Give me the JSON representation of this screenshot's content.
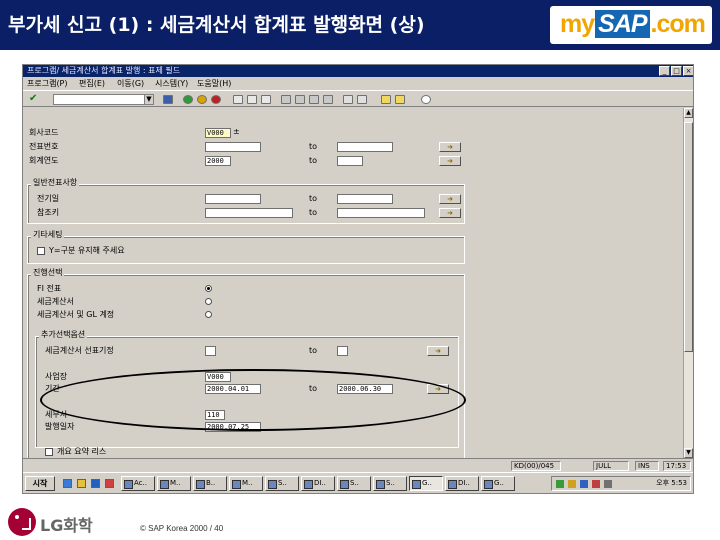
{
  "slide": {
    "title": "부가세 신고 (1) : 세금계산서 합계표 발행화면 (상)",
    "brand_logo": {
      "my": "my",
      "sap": "SAP",
      "com": ".com"
    },
    "company_logo": "LG화학",
    "copyright": "©  SAP Korea 2000 /  40"
  },
  "window": {
    "title": "프로그램/ 세금계산서 합계표 발행 : 표제 필드",
    "controls": [
      "_",
      "□",
      "×"
    ]
  },
  "menu": [
    "프로그램(P)",
    "편집(E)",
    "이동(G)",
    "시스템(Y)",
    "도움말(H)"
  ],
  "toolbar": {
    "enter_icon": "check-icon",
    "command_field": ""
  },
  "selection": {
    "company_code_label": "회사코드",
    "company_code_value": "V000",
    "company_code_marker": "±",
    "doc_no_label": "전표번호",
    "fiscal_year_label": "회계연도",
    "fiscal_year_value": "2000",
    "to": "to"
  },
  "general": {
    "title": "일반전표사항",
    "posting_date_label": "전기일",
    "reference_label": "참조키",
    "to": "to"
  },
  "further": {
    "title": "기타세팅",
    "check_label": "Y=구분 유지해 주세요"
  },
  "processing": {
    "title": "진행선택",
    "opt1": "FI 전표",
    "opt2": "세금계산서",
    "opt3": "세금계산서 및 GL 계정",
    "sub_title": "추가선택옵션",
    "tax_type_label": "세금계산서 선표기정",
    "business_place_label": "사업장",
    "business_place_value": "V000",
    "period_label": "기간",
    "period_from": "2000.04.01",
    "period_to": "2000.06.30",
    "tax_office_label": "세무서",
    "tax_office_value": "110",
    "issue_date_label": "발행일자",
    "issue_date_value": "2000.07.25",
    "to": "to",
    "bottom_check_label": "개요 요약 리스"
  },
  "statusbar": {
    "system": "KD(00)/045",
    "session": "JULL",
    "mode": "INS",
    "time": "17:53"
  },
  "taskbar": {
    "start": "시작",
    "items": [
      "Ac..",
      "M..",
      "B..",
      "M..",
      "S..",
      "DI..",
      "S..",
      "S..",
      "G..",
      "DI..",
      "G.."
    ],
    "clock": "오후 5:53"
  }
}
